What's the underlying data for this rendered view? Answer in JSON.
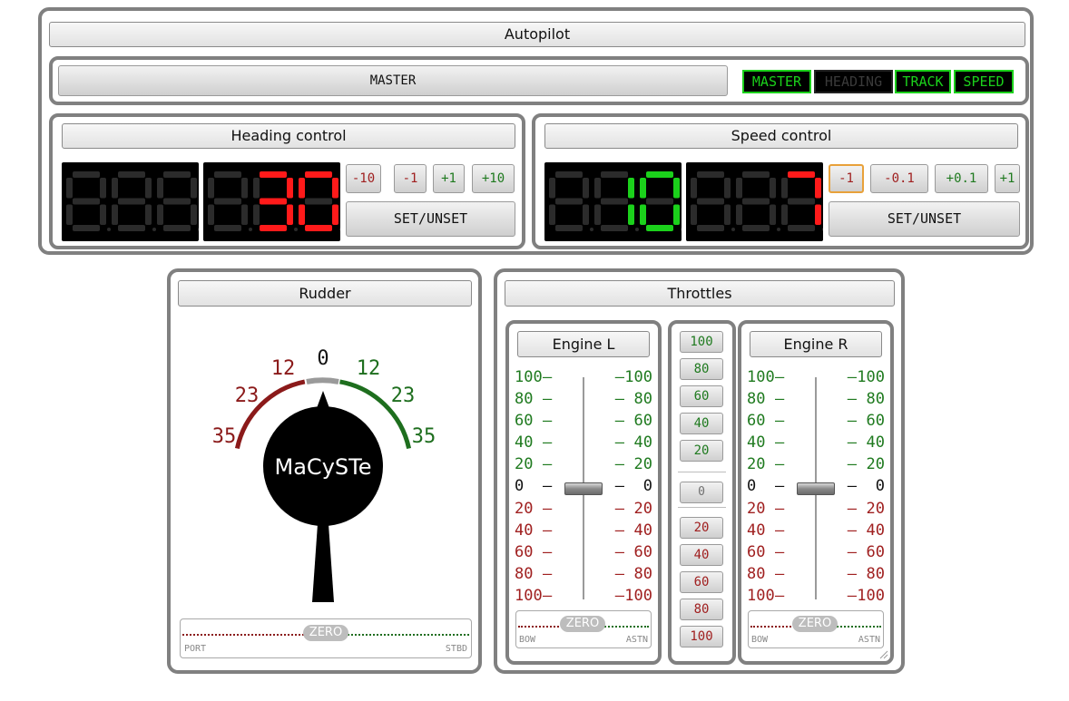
{
  "autopilot": {
    "title": "Autopilot",
    "master_button": "MASTER",
    "modes": [
      {
        "label": "MASTER",
        "active": true
      },
      {
        "label": "HEADING",
        "active": false
      },
      {
        "label": "TRACK",
        "active": true
      },
      {
        "label": "SPEED",
        "active": true
      }
    ],
    "heading": {
      "title": "Heading control",
      "display_1": "888",
      "display_2": "30",
      "buttons": [
        "-10",
        "-1",
        "+1",
        "+10"
      ],
      "set_unset": "SET/UNSET"
    },
    "speed": {
      "title": "Speed control",
      "display_1": "10",
      "display_2": "7",
      "buttons": [
        "-1",
        "-0.1",
        "+0.1",
        "+1"
      ],
      "selected_button": "-1",
      "set_unset": "SET/UNSET"
    }
  },
  "rudder": {
    "title": "Rudder",
    "logo": "MaCySTe",
    "angles": {
      "zero": "0",
      "port_12": "12",
      "port_23": "23",
      "port_35": "35",
      "stbd_12": "12",
      "stbd_23": "23",
      "stbd_35": "35"
    },
    "trim_zero": "ZERO",
    "trim_left": "PORT",
    "trim_right": "STBD",
    "rudder_angle_deg": 0
  },
  "throttles": {
    "title": "Throttles",
    "engine_left": {
      "title": "Engine L",
      "trim_zero": "ZERO",
      "trim_left": "BOW",
      "trim_right": "ASTN",
      "value": 0
    },
    "engine_right": {
      "title": "Engine R",
      "trim_zero": "ZERO",
      "trim_left": "BOW",
      "trim_right": "ASTN",
      "value": 0
    },
    "scale_labels": [
      "100",
      "80",
      "60",
      "40",
      "20",
      "0",
      "20",
      "40",
      "60",
      "80",
      "100"
    ],
    "preset_buttons": [
      "100",
      "80",
      "60",
      "40",
      "20",
      "0",
      "20",
      "40",
      "60",
      "80",
      "100"
    ]
  },
  "colors": {
    "lcd_on_green": "#1bd11b",
    "lcd_on_red": "#ff1a1a",
    "lcd_off": "#2b2b2b",
    "port": "#8b1a1a",
    "starboard": "#1e6e1e",
    "panel_border": "#808080"
  }
}
